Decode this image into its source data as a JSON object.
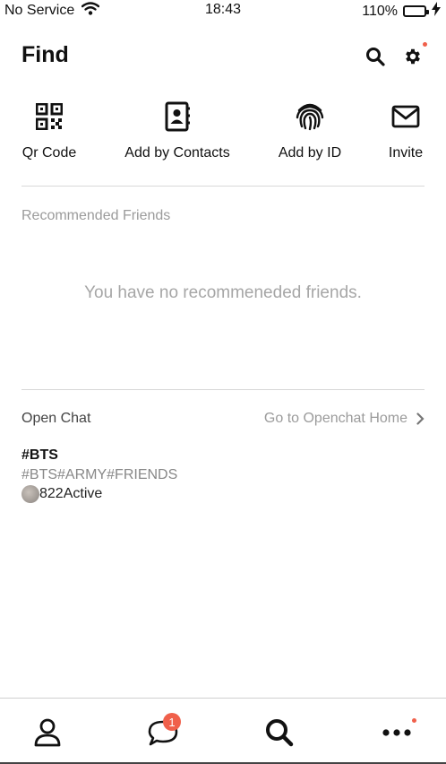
{
  "status_bar": {
    "carrier": "No Service",
    "time": "18:43",
    "battery": "110%"
  },
  "header": {
    "title": "Find"
  },
  "actions": [
    {
      "label": "Qr Code",
      "icon": "qr-code-icon"
    },
    {
      "label": "Add by Contacts",
      "icon": "contacts-book-icon"
    },
    {
      "label": "Add by ID",
      "icon": "fingerprint-icon"
    },
    {
      "label": "Invite",
      "icon": "envelope-icon"
    }
  ],
  "recommended": {
    "label": "Recommended Friends",
    "empty_message": "You have no recommeneded friends."
  },
  "open_chat": {
    "title": "Open Chat",
    "link": "Go to Openchat Home",
    "items": [
      {
        "name": "#BTS",
        "tags": "#BTS#ARMY#FRIENDS",
        "count": "822",
        "status": "Active"
      }
    ]
  },
  "bottom_nav": {
    "chat_badge": "1",
    "items": [
      "friends-icon",
      "chat-bubble-icon",
      "search-icon",
      "more-icon"
    ]
  },
  "colors": {
    "accent_red": "#f0604b",
    "muted_text": "#9b9b9b",
    "divider": "#d8d8d8"
  }
}
